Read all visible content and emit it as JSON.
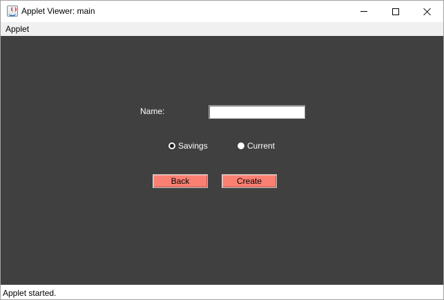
{
  "window": {
    "title": "Applet Viewer: main"
  },
  "menubar": {
    "items": [
      {
        "label": "Applet"
      }
    ]
  },
  "form": {
    "name_label": "Name:",
    "name_value": "",
    "account_type_options": [
      {
        "label": "Savings",
        "selected": true
      },
      {
        "label": "Current",
        "selected": false
      }
    ],
    "back_label": "Back",
    "create_label": "Create",
    "button_color": "#fa8072",
    "panel_color": "#404040"
  },
  "statusbar": {
    "text": "Applet started."
  }
}
